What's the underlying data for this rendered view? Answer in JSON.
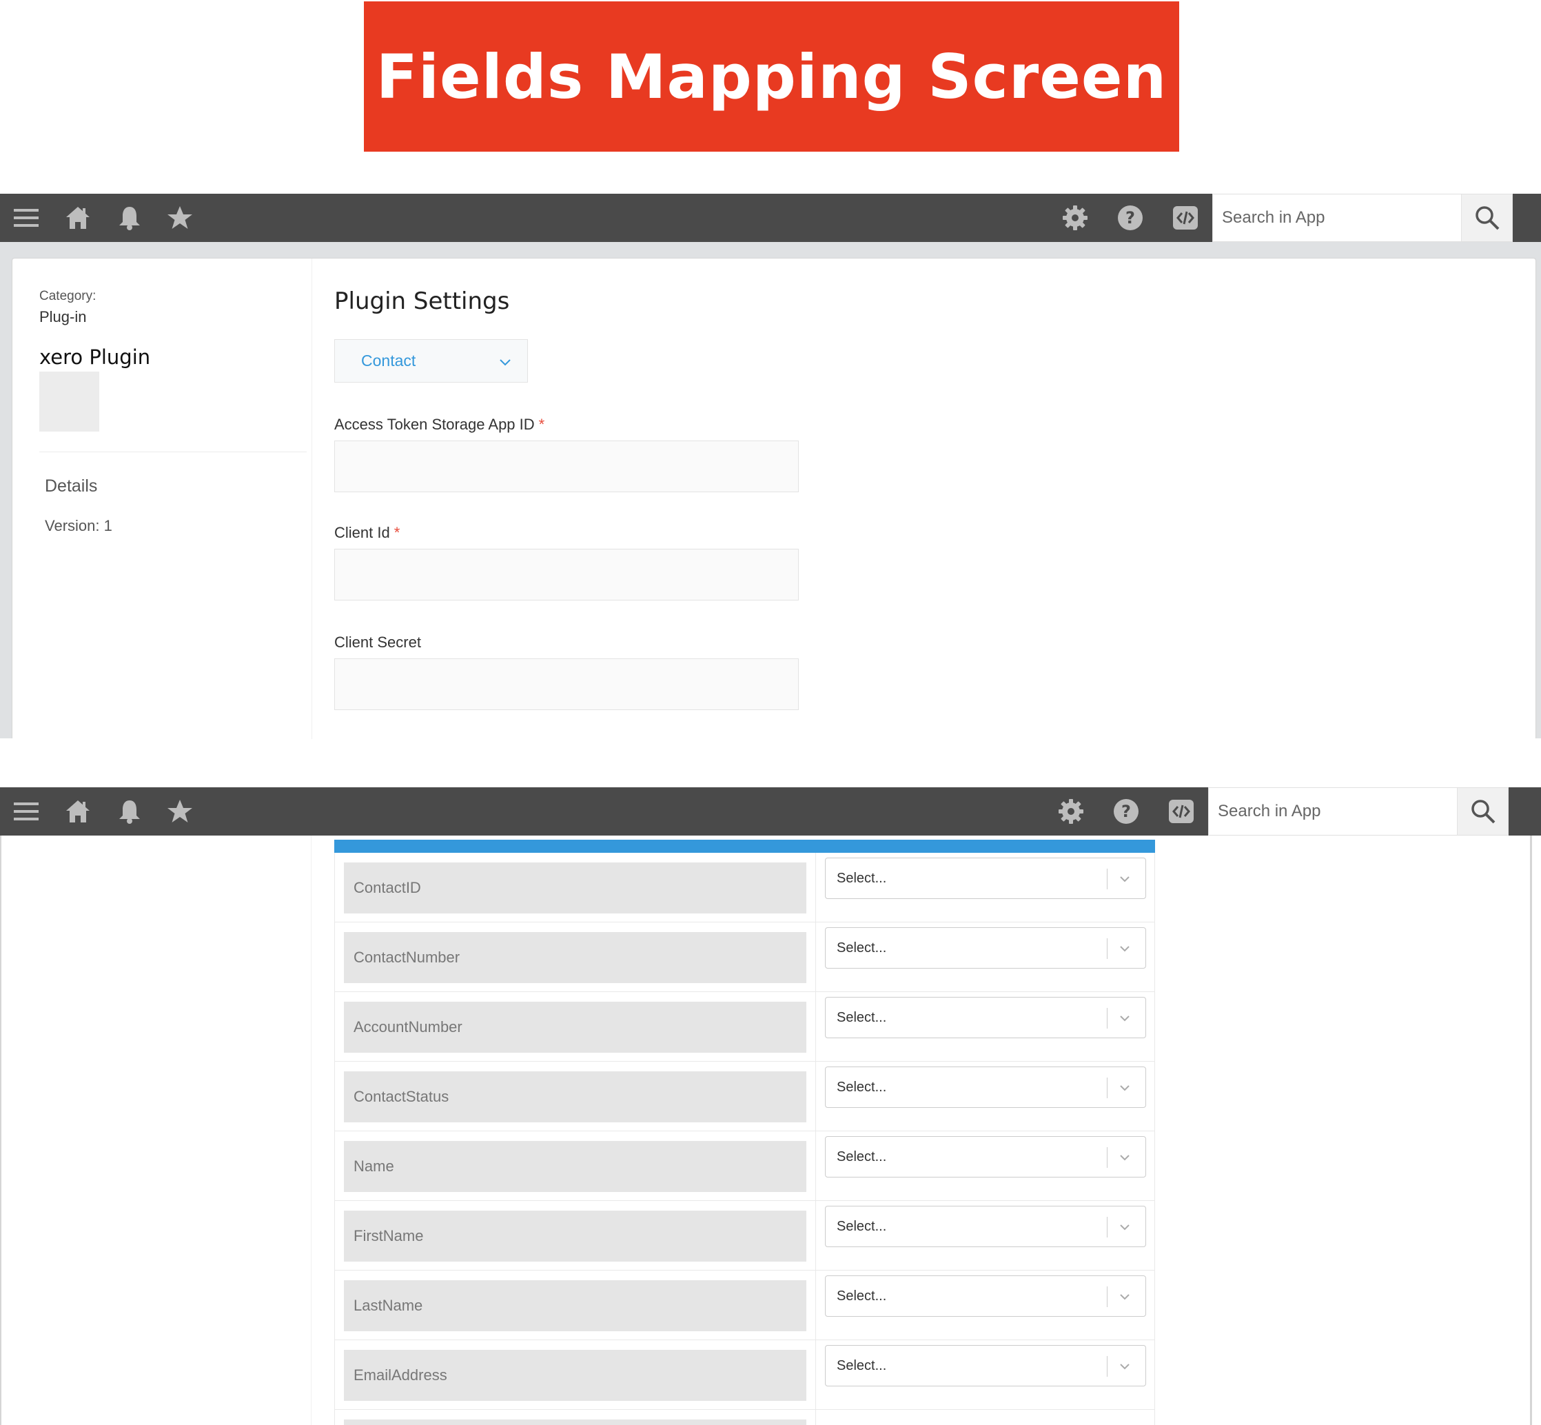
{
  "banner": {
    "title": "Fields Mapping Screen"
  },
  "topbar": {
    "search_placeholder": "Search in App"
  },
  "sidebar": {
    "category_label": "Category:",
    "category_value": "Plug-in",
    "plugin_name": "xero Plugin",
    "details_label": "Details",
    "version_text": "Version: 1"
  },
  "settings": {
    "title": "Plugin Settings",
    "object_dropdown": "Contact",
    "required_mark": "*",
    "fields": [
      {
        "label": "Access Token Storage App ID",
        "required": true,
        "value": ""
      },
      {
        "label": "Client Id",
        "required": true,
        "value": ""
      },
      {
        "label": "Client Secret",
        "required": false,
        "value": ""
      }
    ]
  },
  "mapping": {
    "rows": [
      {
        "field": "ContactID",
        "select": "Select..."
      },
      {
        "field": "ContactNumber",
        "select": "Select..."
      },
      {
        "field": "AccountNumber",
        "select": "Select..."
      },
      {
        "field": "ContactStatus",
        "select": "Select..."
      },
      {
        "field": "Name",
        "select": "Select..."
      },
      {
        "field": "FirstName",
        "select": "Select..."
      },
      {
        "field": "LastName",
        "select": "Select..."
      },
      {
        "field": "EmailAddress",
        "select": "Select..."
      }
    ]
  },
  "colors": {
    "banner": "#e83a21",
    "topbar": "#4a4a4a",
    "accent": "#3498db",
    "required": "#e74c3c"
  }
}
